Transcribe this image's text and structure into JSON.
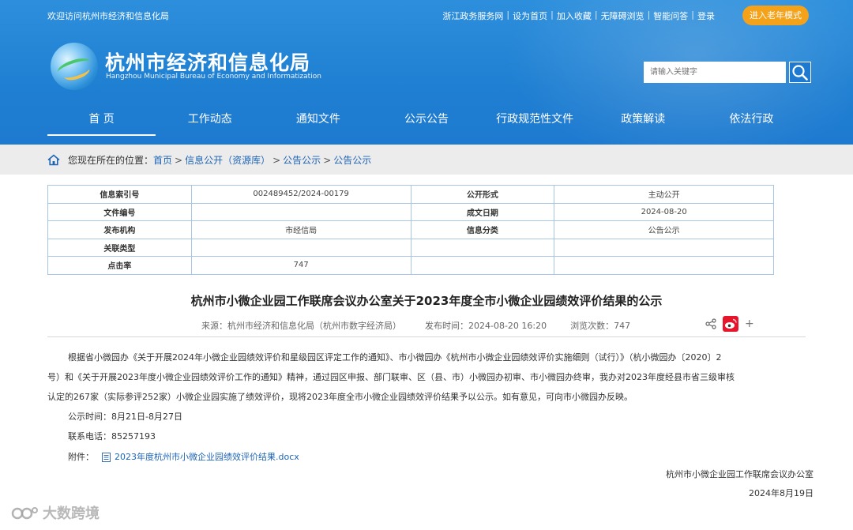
{
  "top_bar": {
    "welcome": "欢迎访问杭州市经济和信息化局",
    "links": [
      "浙江政务服务网",
      "设为首页",
      "加入收藏",
      "无障碍浏览",
      "智能问答",
      "登录"
    ],
    "elder_mode": "进入老年模式"
  },
  "header": {
    "title": "杭州市经济和信息化局",
    "subtitle": "Hangzhou Municipal Bureau of Economy and Informatization",
    "search_placeholder": "请输入关键字"
  },
  "nav": [
    "首 页",
    "工作动态",
    "通知文件",
    "公示公告",
    "行政规范性文件",
    "政策解读",
    "依法行政"
  ],
  "breadcrumb": {
    "prefix": "您现在所在的位置：",
    "items": [
      "首页",
      "信息公开（资源库）",
      "公告公示",
      "公告公示"
    ],
    "sep": ">"
  },
  "meta": [
    [
      "信息索引号",
      "002489452/2024-00179",
      "公开形式",
      "主动公开"
    ],
    [
      "文件编号",
      "",
      "成文日期",
      "2024-08-20"
    ],
    [
      "发布机构",
      "市经信局",
      "信息分类",
      "公告公示"
    ],
    [
      "关联类型",
      "",
      "",
      ""
    ],
    [
      "点击率",
      "747",
      "",
      ""
    ]
  ],
  "article": {
    "title": "杭州市小微企业园工作联席会议办公室关于2023年度全市小微企业园绩效评价结果的公示",
    "source": "来源：杭州市经济和信息化局（杭州市数字经济局）",
    "publish_time": "发布时间：2024-08-20 16:20",
    "views": "浏览次数：747",
    "body_lines": [
      "根据省小微园办《关于开展2024年小微企业园绩效评价和星级园区评定工作的通知》、市小微园办《杭州市小微企业园绩效评价实施细则（试行）》（杭小微园办〔2020〕2",
      "号）和《关于开展2023年度小微企业园绩效评价工作的通知》精神，通过园区申报、部门联审、区（县、市）小微园办初审、市小微园办终审，我办对2023年度经县市省三级审核",
      "认定的267家（实际参评252家）小微企业园实施了绩效评价，现将2023年度全市小微企业园绩效评价结果予以公示。如有意见，可向市小微园办反映。"
    ],
    "period": "公示时间：8月21日-8月27日",
    "phone": "联系电话：85257193",
    "attachment_label": "附件：",
    "attachment_file": "2023年度杭州市小微企业园绩效评价结果.docx",
    "sign_org": "杭州市小微企业园工作联席会议办公室",
    "sign_date": "2024年8月19日"
  },
  "watermark": "大数跨境",
  "colors": {
    "header_blue": "#1e7ad0",
    "elder_orange": "#f5a21b",
    "link_blue": "#1e64b4"
  }
}
